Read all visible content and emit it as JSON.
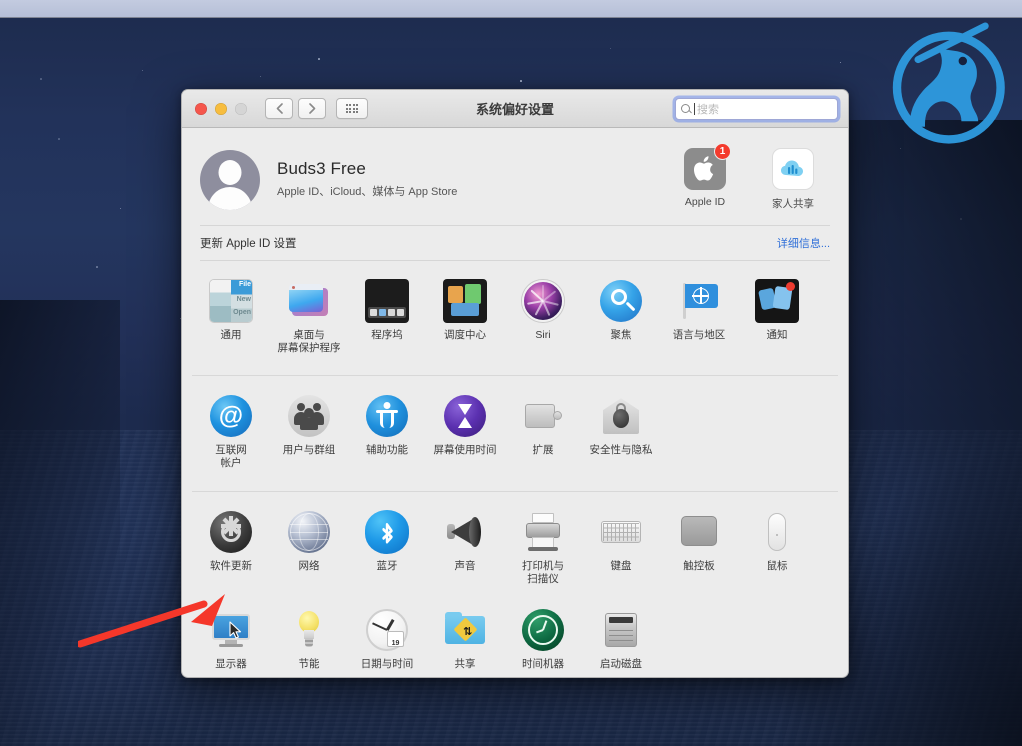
{
  "window": {
    "title": "系统偏好设置",
    "traffic_lights": [
      "close",
      "minimize",
      "zoom-disabled"
    ],
    "nav": {
      "back": "‹",
      "forward": "›",
      "grid": "grid-view"
    },
    "search": {
      "placeholder": "搜索",
      "value": ""
    }
  },
  "account": {
    "name": "Buds3 Free",
    "subtitle": "Apple ID、iCloud、媒体与 App Store",
    "shortcuts": [
      {
        "label": "Apple ID",
        "icon": "apple-logo-icon",
        "badge": "1"
      },
      {
        "label": "家人共享",
        "icon": "family-sharing-cloud-icon",
        "badge": ""
      }
    ]
  },
  "update_bar": {
    "message": "更新 Apple ID 设置",
    "action": "详细信息..."
  },
  "rows": [
    {
      "items": [
        {
          "label": "通用",
          "icon": "general-icon"
        },
        {
          "label": "桌面与\n屏幕保护程序",
          "icon": "desktop-screensaver-icon"
        },
        {
          "label": "程序坞",
          "icon": "dock-icon"
        },
        {
          "label": "调度中心",
          "icon": "mission-control-icon"
        },
        {
          "label": "Siri",
          "icon": "siri-icon"
        },
        {
          "label": "聚焦",
          "icon": "spotlight-icon"
        },
        {
          "label": "语言与地区",
          "icon": "language-region-icon"
        },
        {
          "label": "通知",
          "icon": "notifications-icon"
        }
      ]
    },
    {
      "items": [
        {
          "label": "互联网\n帐户",
          "icon": "internet-accounts-icon"
        },
        {
          "label": "用户与群组",
          "icon": "users-groups-icon"
        },
        {
          "label": "辅助功能",
          "icon": "accessibility-icon"
        },
        {
          "label": "屏幕使用时间",
          "icon": "screen-time-icon"
        },
        {
          "label": "扩展",
          "icon": "extensions-icon"
        },
        {
          "label": "安全性与隐私",
          "icon": "security-privacy-icon"
        }
      ]
    },
    {
      "items": [
        {
          "label": "软件更新",
          "icon": "software-update-icon"
        },
        {
          "label": "网络",
          "icon": "network-icon"
        },
        {
          "label": "蓝牙",
          "icon": "bluetooth-icon"
        },
        {
          "label": "声音",
          "icon": "sound-icon"
        },
        {
          "label": "打印机与\n扫描仪",
          "icon": "printers-scanners-icon"
        },
        {
          "label": "键盘",
          "icon": "keyboard-icon"
        },
        {
          "label": "触控板",
          "icon": "trackpad-icon"
        },
        {
          "label": "鼠标",
          "icon": "mouse-icon"
        }
      ]
    },
    {
      "items": [
        {
          "label": "显示器",
          "icon": "displays-icon"
        },
        {
          "label": "节能",
          "icon": "energy-saver-icon"
        },
        {
          "label": "日期与时间",
          "icon": "date-time-icon"
        },
        {
          "label": "共享",
          "icon": "sharing-icon"
        },
        {
          "label": "时间机器",
          "icon": "time-machine-icon"
        },
        {
          "label": "启动磁盘",
          "icon": "startup-disk-icon"
        }
      ]
    }
  ],
  "annotation": {
    "type": "red-arrow",
    "points_to": "显示器"
  },
  "desktop": {
    "watermark": "knight-logo-watermark"
  },
  "colors": {
    "window_bg": "#ececec",
    "titlebar": "#e0e0e0",
    "accent_link": "#2f6fd8",
    "badge_red": "#f43b2d",
    "arrow_red": "#f5372a",
    "wallpaper_sky": "#22325a",
    "wallpaper_ocean": "#203055"
  },
  "calendar_day": "19"
}
